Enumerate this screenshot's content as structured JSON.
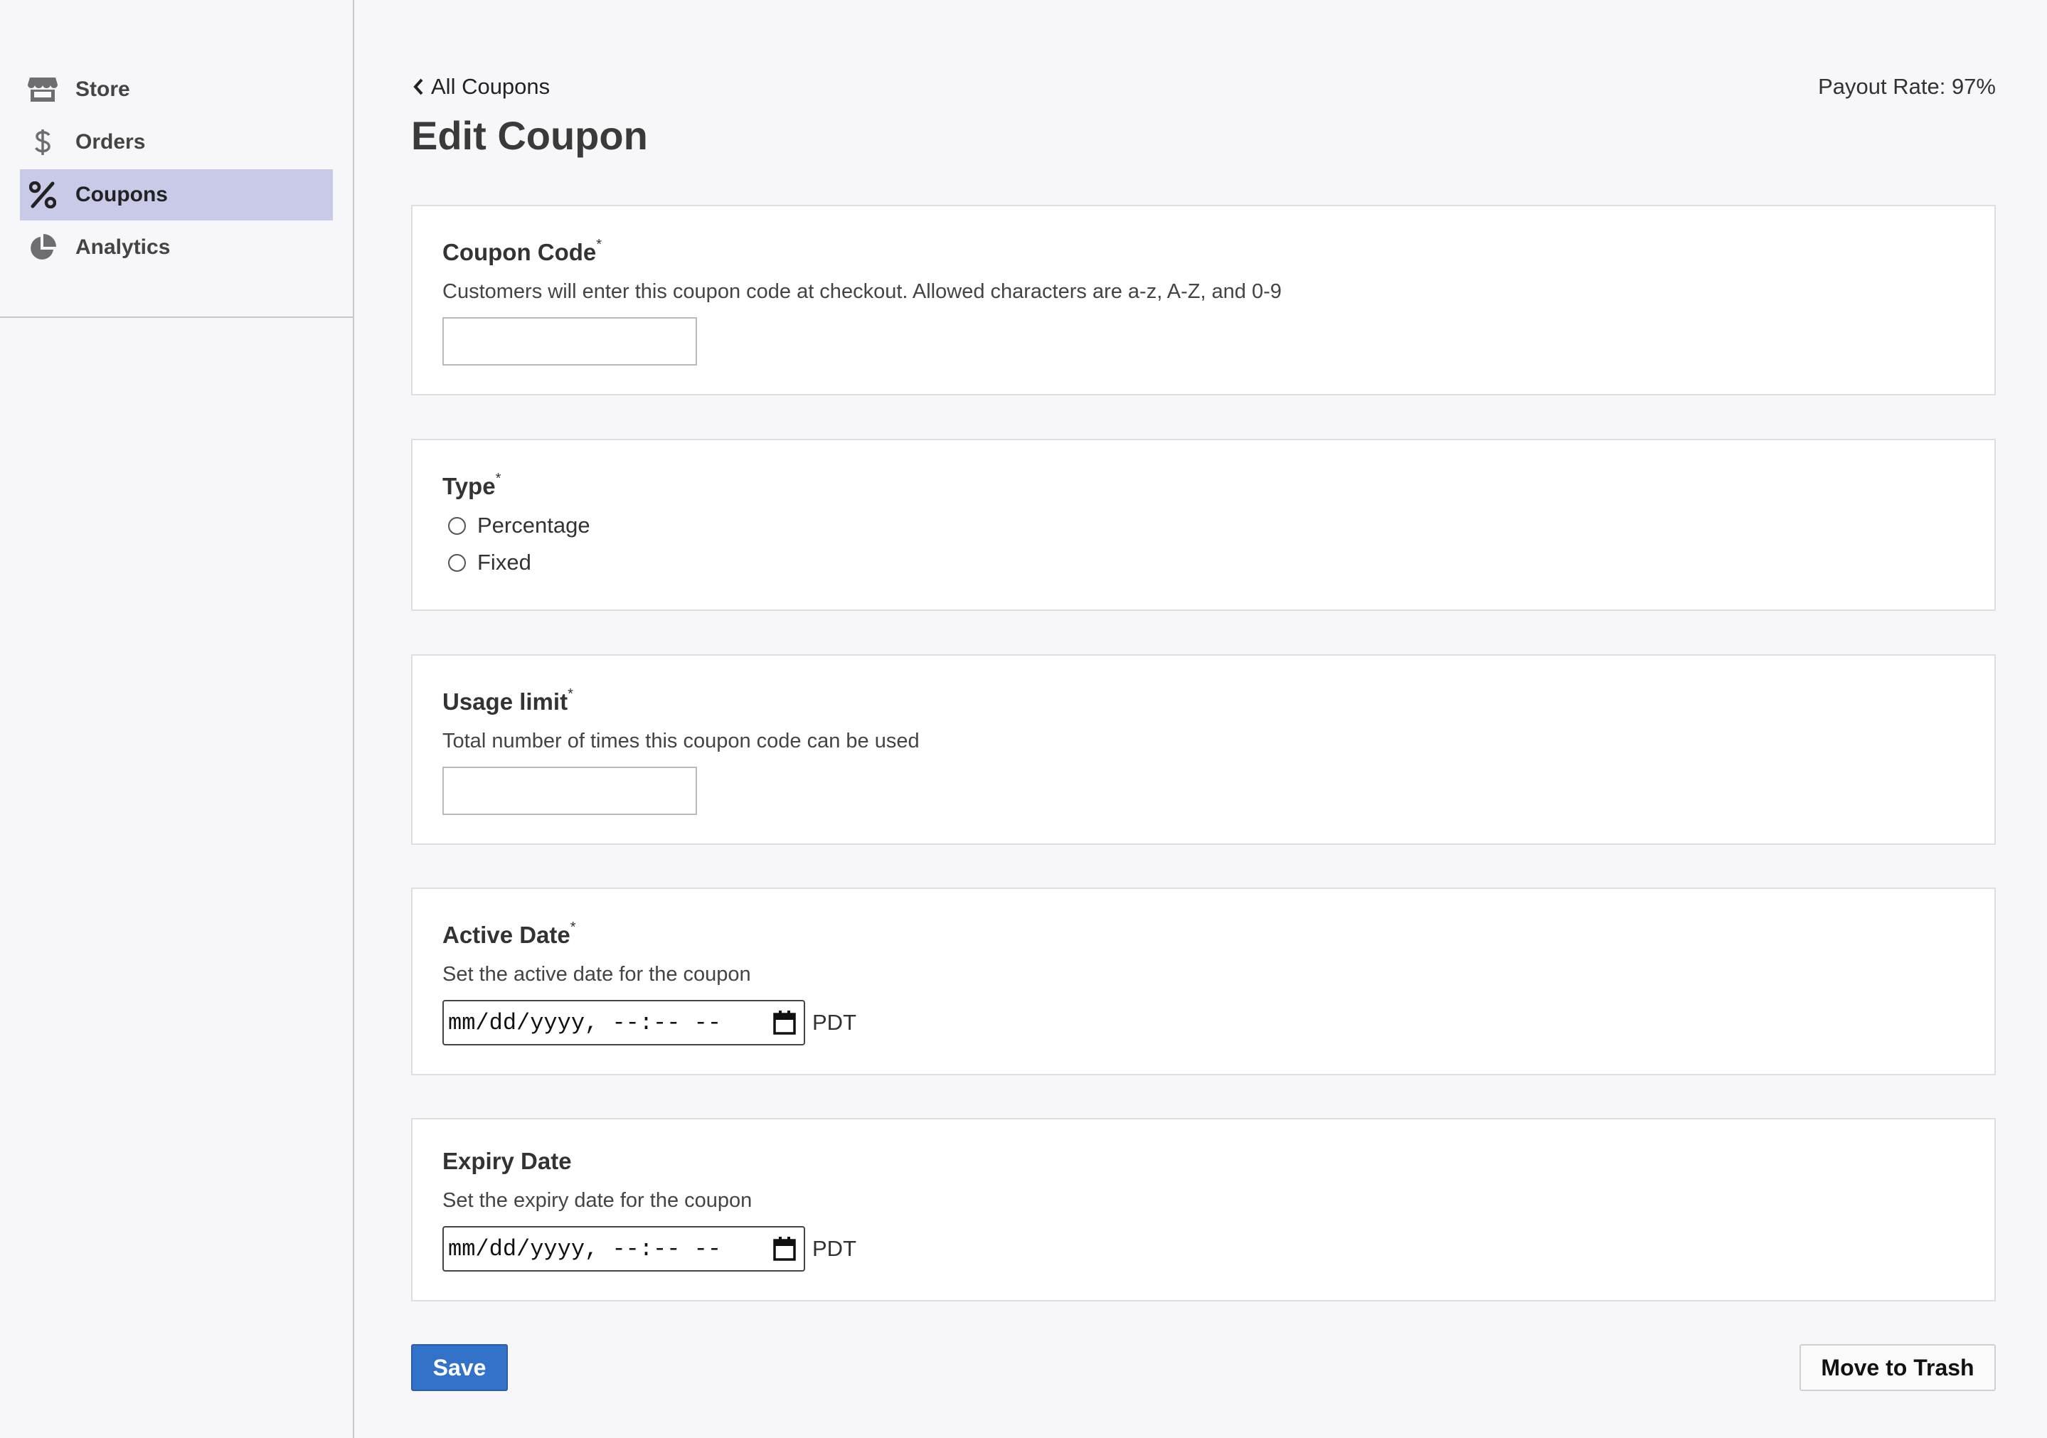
{
  "sidebar": {
    "items": [
      {
        "label": "Store",
        "icon": "store-icon"
      },
      {
        "label": "Orders",
        "icon": "dollar-icon"
      },
      {
        "label": "Coupons",
        "icon": "percent-icon",
        "active": true
      },
      {
        "label": "Analytics",
        "icon": "pie-chart-icon"
      }
    ]
  },
  "header": {
    "back_label": "All Coupons",
    "payout": "Payout Rate: 97%",
    "title": "Edit Coupon"
  },
  "form": {
    "coupon_code": {
      "label": "Coupon Code",
      "required": "*",
      "description": "Customers will enter this coupon code at checkout. Allowed characters are a-z, A-Z, and 0-9",
      "value": ""
    },
    "type": {
      "label": "Type",
      "required": "*",
      "options": [
        "Percentage",
        "Fixed"
      ]
    },
    "usage_limit": {
      "label": "Usage limit",
      "required": "*",
      "description": "Total number of times this coupon code can be used",
      "value": ""
    },
    "active_date": {
      "label": "Active Date",
      "required": "*",
      "description": "Set the active date for the coupon",
      "placeholder": "mm/dd/yyyy, --:-- --",
      "timezone": "PDT"
    },
    "expiry_date": {
      "label": "Expiry Date",
      "description": "Set the expiry date for the coupon",
      "placeholder": "mm/dd/yyyy, --:-- --",
      "timezone": "PDT"
    }
  },
  "actions": {
    "save_label": "Save",
    "trash_label": "Move to Trash"
  },
  "colors": {
    "accent": "#3372c9",
    "active_nav": "#c8cae8",
    "background": "#f7f7fa"
  }
}
